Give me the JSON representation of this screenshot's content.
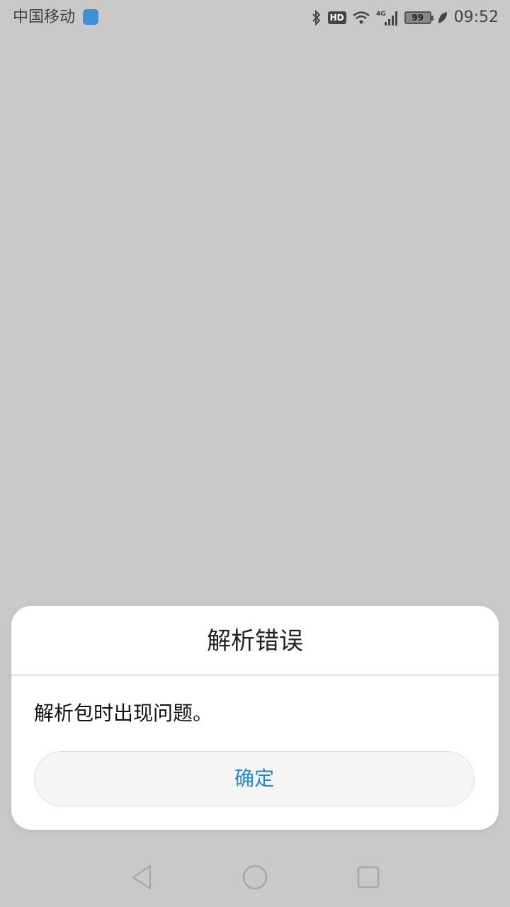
{
  "status_bar": {
    "carrier": "中国移动",
    "hd": "HD",
    "network": "4G",
    "battery": "99",
    "time": "09:52"
  },
  "dialog": {
    "title": "解析错误",
    "message": "解析包时出现问题。",
    "confirm_label": "确定",
    "accent_color": "#1e88d8"
  },
  "nav_bar": {
    "icons": [
      "back-icon",
      "home-icon",
      "recents-icon"
    ]
  }
}
